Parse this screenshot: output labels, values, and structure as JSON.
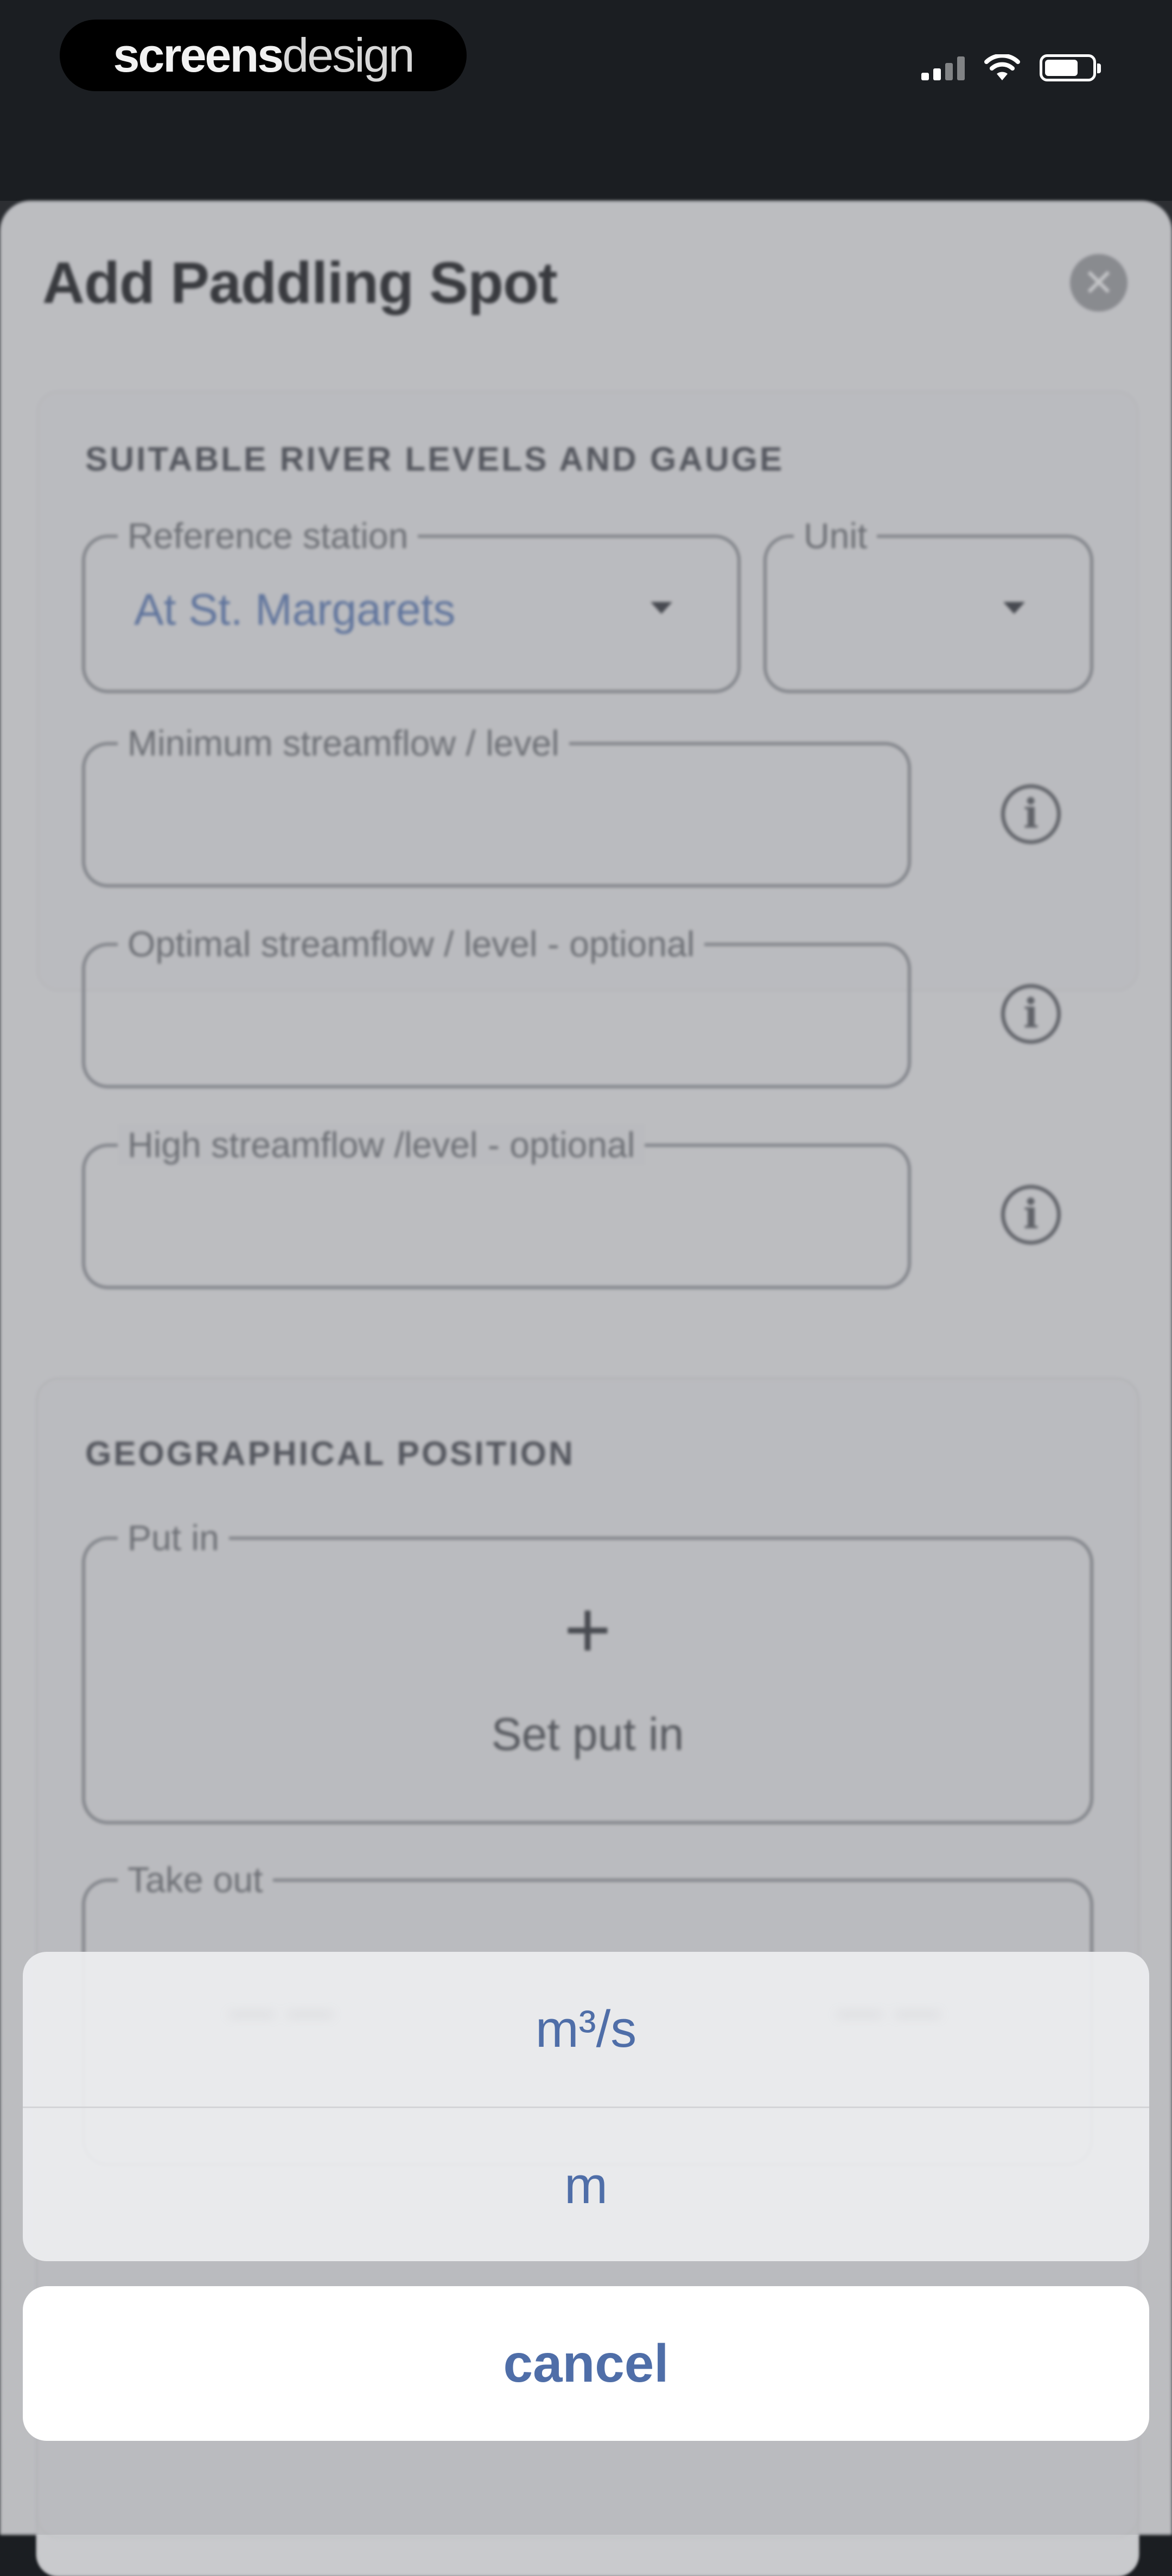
{
  "status_bar": {
    "brand_bold": "screens",
    "brand_light": "design"
  },
  "sheet": {
    "title": "Add Paddling Spot",
    "close_icon": "close-x-icon"
  },
  "levels_section": {
    "heading": "SUITABLE RIVER LEVELS AND GAUGE",
    "reference_station": {
      "label": "Reference station",
      "value": "At St. Margarets"
    },
    "unit": {
      "label": "Unit",
      "value": ""
    },
    "minimum": {
      "label": "Minimum streamflow / level",
      "value": ""
    },
    "optimal": {
      "label": "Optimal streamflow / level - optional",
      "value": ""
    },
    "high": {
      "label": "High streamflow /level - optional",
      "value": ""
    }
  },
  "geo_section": {
    "heading": "GEOGRAPHICAL POSITION",
    "put_in": {
      "label": "Put in",
      "action": "Set put in",
      "icon": "+"
    },
    "take_out": {
      "label": "Take out"
    }
  },
  "action_sheet": {
    "options": [
      "m³/s",
      "m"
    ],
    "cancel": "cancel"
  },
  "colors": {
    "accent": "#4f6ea8",
    "sheet_bg": "#cbcccf",
    "status_bg": "#1b1e22"
  }
}
